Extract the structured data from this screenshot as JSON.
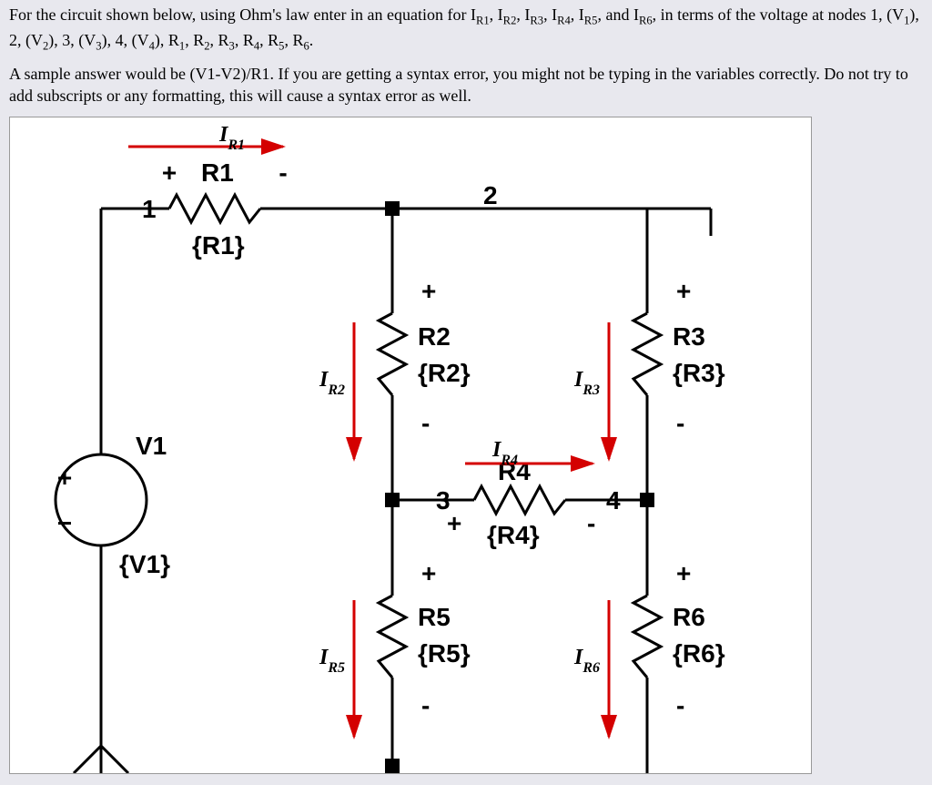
{
  "problem": {
    "p1_html": "For the circuit shown below, using Ohm's law enter in an equation for I<sub>R1</sub>, I<sub>R2</sub>, I<sub>R3</sub>, I<sub>R4</sub>, I<sub>R5</sub>, and I<sub>R6</sub>, in terms of the voltage at nodes 1, (V<sub>1</sub>), 2, (V<sub>2</sub>), 3, (V<sub>3</sub>), 4, (V<sub>4</sub>), R<sub>1</sub>, R<sub>2</sub>, R<sub>3</sub>, R<sub>4</sub>, R<sub>5</sub>, R<sub>6</sub>.",
    "p2": "A sample answer would be (V1-V2)/R1.  If you are getting a syntax error, you might not be typing in the variables correctly.  Do not try to add subscripts or any formatting, this will cause a syntax error as well."
  },
  "circuit": {
    "nodes": {
      "n1": "1",
      "n2": "2",
      "n3": "3",
      "n4": "4"
    },
    "source": {
      "label": "V1",
      "value": "{V1}",
      "plus": "+",
      "minus": "−"
    },
    "components": {
      "R1": {
        "label": "R1",
        "value": "{R1}",
        "current": "IR1",
        "current_html": "I<sub>R1</sub>"
      },
      "R2": {
        "label": "R2",
        "value": "{R2}",
        "current": "IR2",
        "current_html": "I<sub>R2</sub>"
      },
      "R3": {
        "label": "R3",
        "value": "{R3}",
        "current": "IR3",
        "current_html": "I<sub>R3</sub>"
      },
      "R4": {
        "label": "R4",
        "value": "{R4}",
        "current": "IR4",
        "current_html": "I<sub>R4</sub>"
      },
      "R5": {
        "label": "R5",
        "value": "{R5}",
        "current": "IR5",
        "current_html": "I<sub>R5</sub>"
      },
      "R6": {
        "label": "R6",
        "value": "{R6}",
        "current": "IR6",
        "current_html": "I<sub>R6</sub>"
      }
    },
    "polarity": {
      "plus": "+",
      "minus": "-"
    }
  }
}
